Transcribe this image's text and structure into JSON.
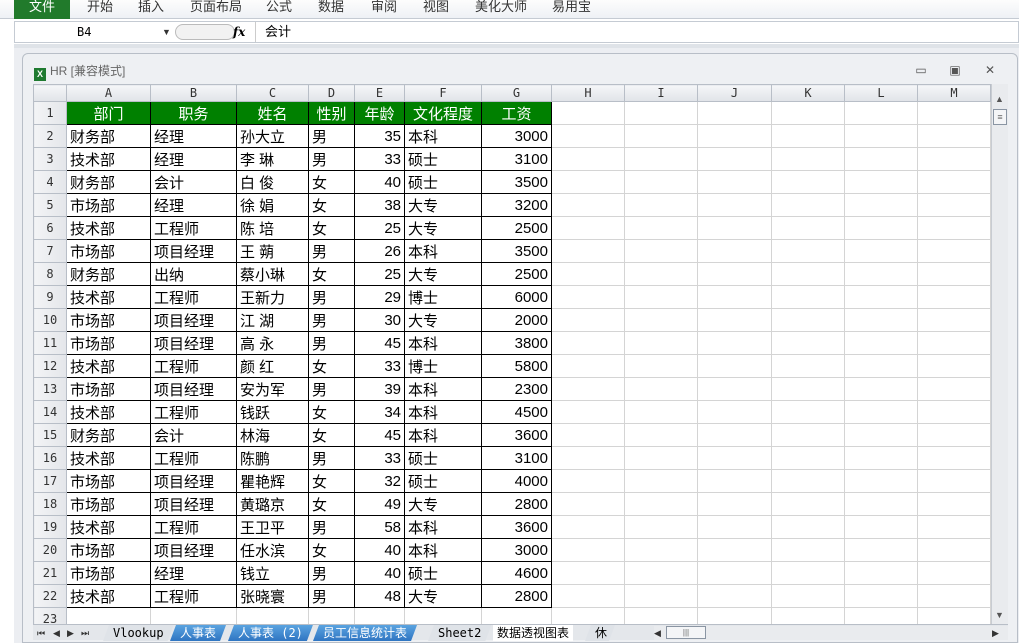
{
  "ribbon": {
    "file": "文件",
    "tabs": [
      "开始",
      "插入",
      "页面布局",
      "公式",
      "数据",
      "审阅",
      "视图",
      "美化大师",
      "易用宝"
    ]
  },
  "formula_bar": {
    "name_box": "B4",
    "fx": "fx",
    "value": "会计"
  },
  "window": {
    "title": "HR  [兼容模式]",
    "icon": "excel-icon"
  },
  "columns": [
    "A",
    "B",
    "C",
    "D",
    "E",
    "F",
    "G",
    "H",
    "I",
    "J",
    "K",
    "L",
    "M"
  ],
  "table": {
    "headers": [
      "部门",
      "职务",
      "姓名",
      "性别",
      "年龄",
      "文化程度",
      "工资"
    ],
    "rows": [
      [
        "财务部",
        "经理",
        "孙大立",
        "男",
        "35",
        "本科",
        "3000"
      ],
      [
        "技术部",
        "经理",
        "李  琳",
        "男",
        "33",
        "硕士",
        "3100"
      ],
      [
        "财务部",
        "会计",
        "白  俊",
        "女",
        "40",
        "硕士",
        "3500"
      ],
      [
        "市场部",
        "经理",
        "徐  娟",
        "女",
        "38",
        "大专",
        "3200"
      ],
      [
        "技术部",
        "工程师",
        "陈  培",
        "女",
        "25",
        "大专",
        "2500"
      ],
      [
        "市场部",
        "项目经理",
        "王  蒴",
        "男",
        "26",
        "本科",
        "3500"
      ],
      [
        "财务部",
        "出纳",
        "蔡小琳",
        "女",
        "25",
        "大专",
        "2500"
      ],
      [
        "技术部",
        "工程师",
        "王新力",
        "男",
        "29",
        "博士",
        "6000"
      ],
      [
        "市场部",
        "项目经理",
        "江  湖",
        "男",
        "30",
        "大专",
        "2000"
      ],
      [
        "市场部",
        "项目经理",
        "高  永",
        "男",
        "45",
        "本科",
        "3800"
      ],
      [
        "技术部",
        "工程师",
        "颜  红",
        "女",
        "33",
        "博士",
        "5800"
      ],
      [
        "市场部",
        "项目经理",
        "安为军",
        "男",
        "39",
        "本科",
        "2300"
      ],
      [
        "技术部",
        "工程师",
        "钱跃",
        "女",
        "34",
        "本科",
        "4500"
      ],
      [
        "财务部",
        "会计",
        "林海",
        "女",
        "45",
        "本科",
        "3600"
      ],
      [
        "技术部",
        "工程师",
        "陈鹏",
        "男",
        "33",
        "硕士",
        "3100"
      ],
      [
        "市场部",
        "项目经理",
        "瞿艳辉",
        "女",
        "32",
        "硕士",
        "4000"
      ],
      [
        "市场部",
        "项目经理",
        "黄璐京",
        "女",
        "49",
        "大专",
        "2800"
      ],
      [
        "技术部",
        "工程师",
        "王卫平",
        "男",
        "58",
        "本科",
        "3600"
      ],
      [
        "市场部",
        "项目经理",
        "任水滨",
        "女",
        "40",
        "本科",
        "3000"
      ],
      [
        "市场部",
        "经理",
        "钱立",
        "男",
        "40",
        "硕士",
        "4600"
      ],
      [
        "技术部",
        "工程师",
        "张晓寰",
        "男",
        "48",
        "大专",
        "2800"
      ]
    ]
  },
  "sheet_tabs": [
    "Vlookup",
    "人事表",
    "人事表 (2)",
    "员工信息统计表",
    "Sheet2",
    "数据透视图表",
    "休"
  ],
  "active_sheet": "数据透视图表",
  "colors": {
    "header_fill": "#008000",
    "file_tab": "#217a2b"
  }
}
